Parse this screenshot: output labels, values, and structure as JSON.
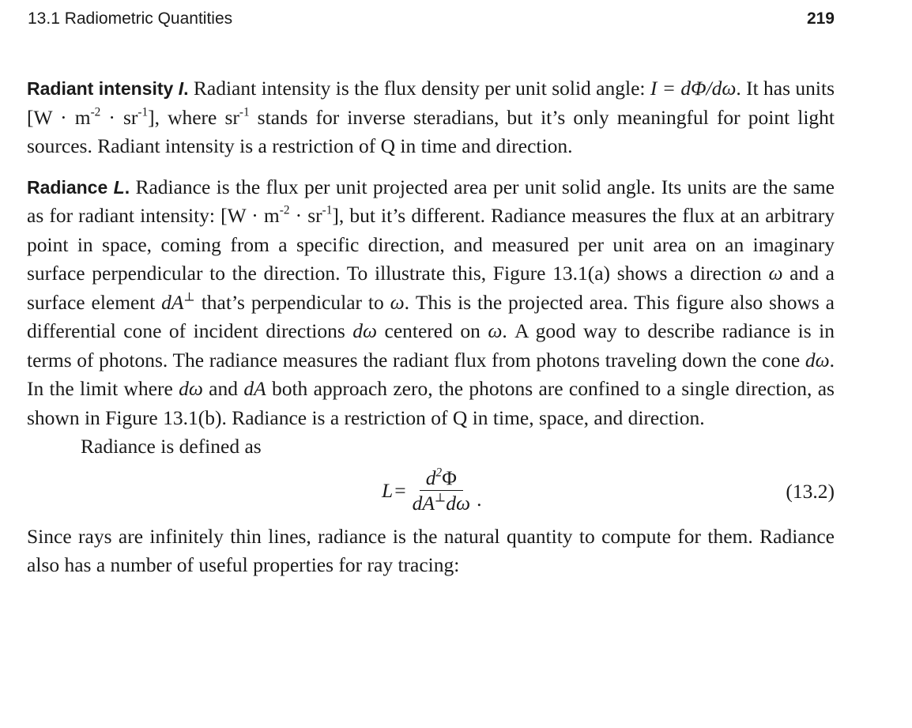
{
  "header": {
    "section_title": "13.1 Radiometric Quantities",
    "page_number": "219"
  },
  "radiant_intensity": {
    "heading": "Radiant intensity ",
    "symbol": "I",
    "heading_end": ".",
    "lines": [
      " Radiant intensity is the flux density per unit solid angle: ",
      "I = dΦ/dω",
      ". It has units [W · m",
      "-2",
      " · sr",
      "-1",
      "], where sr",
      "-1",
      " stands for inverse steradians, but it’s only meaningful for point light sources. Radiant intensity is a restriction of Q in time and direction."
    ]
  },
  "radiance": {
    "heading": "Radiance ",
    "symbol": "L",
    "heading_end": ".",
    "t1": " Radiance is the flux per unit projected area per unit solid angle. Its units are the same as for radiant intensity: [W · m",
    "t1_sup1": "-2",
    "t2": " · sr",
    "t2_sup": "-1",
    "t3": "], but it’s different. Radiance measures the flux at an arbitrary point in space, coming from a specific direction, and measured per unit area on an imaginary surface perpendicular to the direction. To illustrate this, Figure 13.1(a) shows a direction ",
    "omega1": "ω",
    "t4": " and a surface element ",
    "dA": "dA",
    "perp": "⊥",
    "t5": " that’s perpendicular to ",
    "omega2": "ω",
    "t6": ". This is the projected area. This figure also shows a differential cone of incident directions ",
    "domega1": "dω",
    "t7": " centered on ",
    "omega3": "ω",
    "t8": ". A good way to describe radiance is in terms of photons. The radiance measures the radiant flux from photons traveling down the cone ",
    "domega2": "dω",
    "t9": ". In the limit where ",
    "domega3": "dω",
    "t10": " and ",
    "dA2": "dA",
    "t11": " both approach zero, the photons are confined to a single direction, as shown in Figure 13.1(b). Radiance is a restriction of Q in time, space, and direction."
  },
  "definition_intro": "Radiance is defined as",
  "equation": {
    "lhs": "L",
    "equals": "=",
    "numerator_d": "d",
    "numerator_exp": "2",
    "numerator_phi": "Φ",
    "denominator_dA": "dA",
    "denominator_perp": "⊥",
    "denominator_domega": "dω",
    "end": ".",
    "number": "(13.2)"
  },
  "closing_paragraph": "Since rays are infinitely thin lines, radiance is the natural quantity to compute for them. Radiance also has a number of useful properties for ray tracing:"
}
